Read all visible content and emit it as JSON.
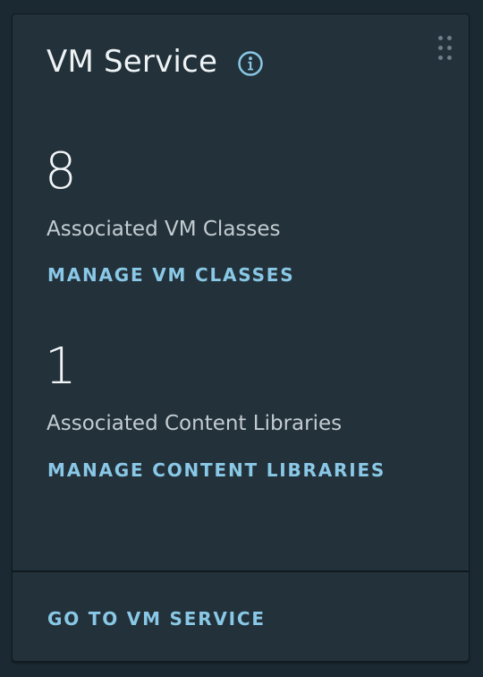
{
  "card": {
    "title": "VM Service",
    "vm_classes": {
      "count": "8",
      "label": "Associated VM Classes",
      "action": "MANAGE VM CLASSES"
    },
    "content_libraries": {
      "count": "1",
      "label": "Associated Content Libraries",
      "action": "MANAGE CONTENT LIBRARIES"
    },
    "footer_action": "GO TO VM SERVICE"
  },
  "icons": {
    "info": "info-icon",
    "drag": "drag-handle-icon"
  },
  "colors": {
    "background": "#1b2a32",
    "card": "#23313a",
    "link": "#89c8e6",
    "text_primary": "#eef3f5",
    "text_secondary": "#c3ccd1"
  }
}
